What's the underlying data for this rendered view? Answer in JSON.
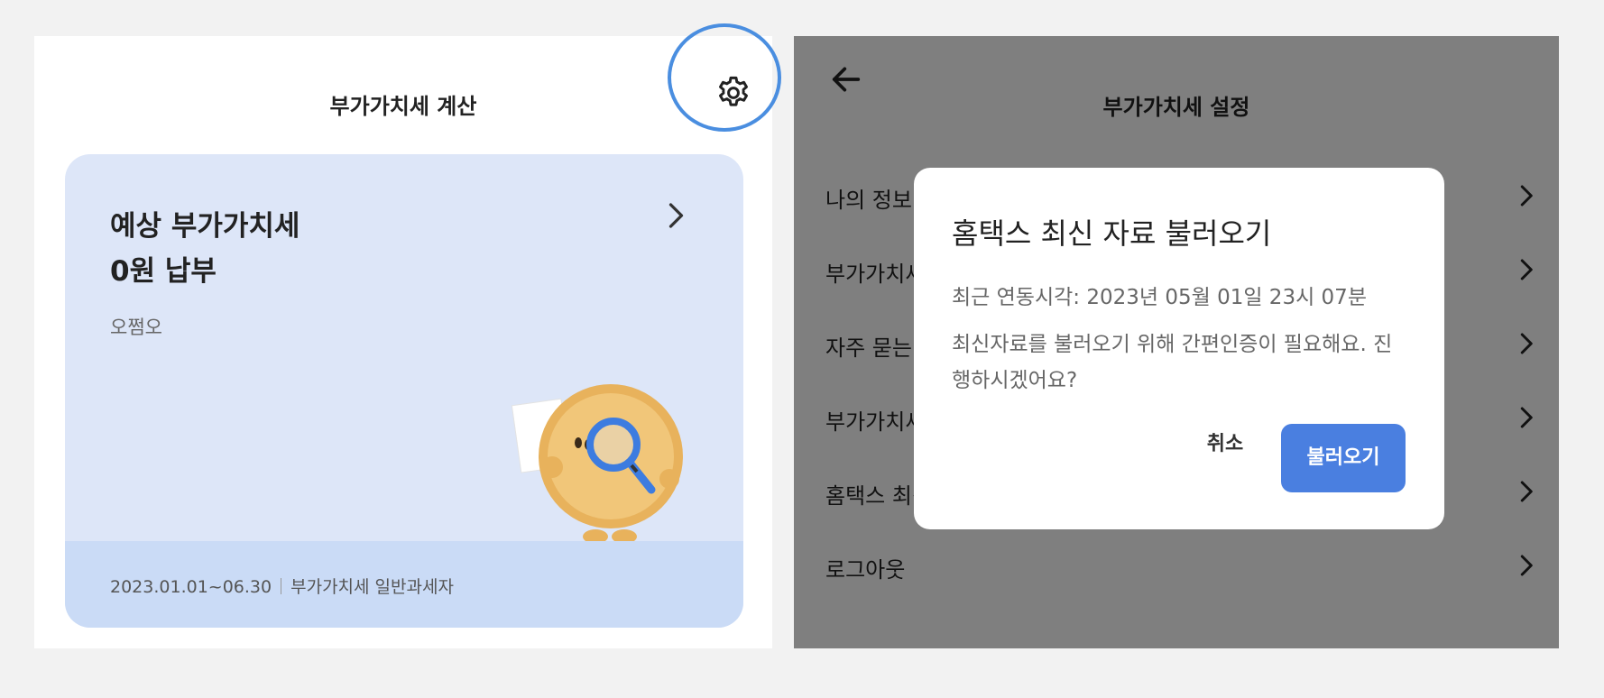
{
  "left_screen": {
    "title": "부가가치세 계산",
    "settings_icon": "gear-icon",
    "card": {
      "title_line1": "예상 부가가치세",
      "title_line2": "0원 납부",
      "subtitle": "오쩜오",
      "chevron_icon": "chevron-right-icon",
      "footer_period": "2023.01.01~06.30",
      "footer_type": "부가가치세 일반과세자"
    }
  },
  "right_screen": {
    "title": "부가가치세 설정",
    "back_icon": "arrow-left-icon",
    "menu": [
      {
        "label": "나의 정보"
      },
      {
        "label": "부가가치세"
      },
      {
        "label": "자주 묻는 질문"
      },
      {
        "label": "부가가치세"
      },
      {
        "label": "홈택스 최신"
      },
      {
        "label": "로그아웃"
      }
    ],
    "dialog": {
      "title": "홈택스 최신 자료 불러오기",
      "sync_time": "최근 연동시각: 2023년 05월 01일 23시 07분",
      "message": "최신자료를 불러오기 위해 간편인증이 필요해요. 진행하시겠어요?",
      "cancel_label": "취소",
      "confirm_label": "불러오기"
    }
  },
  "colors": {
    "accent": "#4a7fe0",
    "highlight_ring": "#4a8ee0",
    "card_bg": "#dde6f8",
    "card_footer_bg": "#cadbf6",
    "overlay": "rgba(0,0,0,0.5)"
  }
}
